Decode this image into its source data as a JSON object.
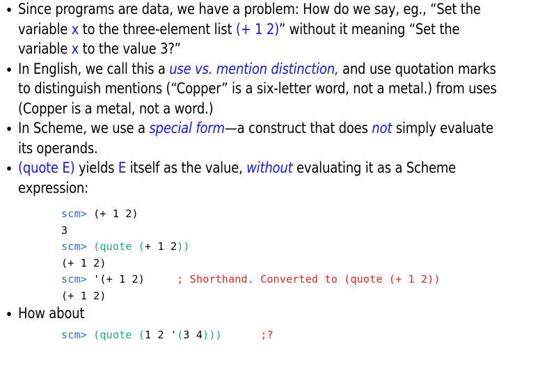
{
  "slide": {
    "background": "#ffffff",
    "accent_blue": "#1414f0",
    "code_prompt_blue": "#2e6fc4",
    "code_keyword_green": "#1eb07a",
    "code_paren_teal": "#17a98f",
    "code_comment_red": "#f42020"
  },
  "bullets": [
    {
      "id": "bullet-problem",
      "segments": [
        {
          "text": "Since programs are data, we have a problem:  How do we say, eg., “Set the variable ",
          "style": "plain"
        },
        {
          "text": "x",
          "style": "blue"
        },
        {
          "text": " to the three-element list ",
          "style": "plain"
        },
        {
          "text": "(+ 1 2)",
          "style": "blue"
        },
        {
          "text": "” without it meaning “Set the variable ",
          "style": "plain"
        },
        {
          "text": "x",
          "style": "blue"
        },
        {
          "text": " to the value 3?”",
          "style": "plain"
        }
      ]
    },
    {
      "id": "bullet-use-mention",
      "segments": [
        {
          "text": "In English, we call this a ",
          "style": "plain"
        },
        {
          "text": "use vs. mention distinction,",
          "style": "blue-italic"
        },
        {
          "text": " and use quotation marks to distinguish mentions (“Copper” is a six-letter word, not a metal.) from uses (Copper is a metal, not a word.)",
          "style": "plain"
        }
      ]
    },
    {
      "id": "bullet-special-form",
      "segments": [
        {
          "text": "In Scheme, we use a ",
          "style": "plain"
        },
        {
          "text": "special form",
          "style": "blue-italic"
        },
        {
          "text": "—a construct that does ",
          "style": "plain"
        },
        {
          "text": "not",
          "style": "blue-italic"
        },
        {
          "text": " simply evaluate its operands.",
          "style": "plain"
        }
      ]
    },
    {
      "id": "bullet-quote",
      "segments": [
        {
          "text": "(quote E)",
          "style": "blue"
        },
        {
          "text": " yields ",
          "style": "plain"
        },
        {
          "text": "E",
          "style": "blue"
        },
        {
          "text": " itself as the value, ",
          "style": "plain"
        },
        {
          "text": "without",
          "style": "blue-italic"
        },
        {
          "text": " evaluating it as a Scheme expression:",
          "style": "plain"
        }
      ]
    },
    {
      "id": "bullet-how-about",
      "segments": [
        {
          "text": "How about",
          "style": "plain"
        }
      ]
    }
  ],
  "code_block_first": {
    "id": "repl-transcript-main",
    "lines": [
      [
        {
          "text": "scm>",
          "style": "prompt"
        },
        {
          "text": " (+ 1 2)",
          "style": "plain"
        }
      ],
      [
        {
          "text": "3",
          "style": "plain"
        }
      ],
      [
        {
          "text": "scm>",
          "style": "prompt"
        },
        {
          "text": " ",
          "style": "plain"
        },
        {
          "text": "(",
          "style": "paren"
        },
        {
          "text": "quote",
          "style": "keyword"
        },
        {
          "text": " ",
          "style": "plain"
        },
        {
          "text": "(",
          "style": "paren"
        },
        {
          "text": "+ 1 2",
          "style": "plain"
        },
        {
          "text": "))",
          "style": "paren"
        }
      ],
      [
        {
          "text": "(+ 1 2)",
          "style": "plain"
        }
      ],
      [
        {
          "text": "scm>",
          "style": "prompt"
        },
        {
          "text": " '(+ 1 2)",
          "style": "plain"
        },
        {
          "text": "     ",
          "style": "plain"
        },
        {
          "text": "; Shorthand. Converted to (quote (+ 1 2))",
          "style": "comment"
        }
      ],
      [
        {
          "text": "(+ 1 2)",
          "style": "plain"
        }
      ]
    ]
  },
  "code_block_last": {
    "id": "repl-transcript-how-about",
    "lines": [
      [
        {
          "text": "scm>",
          "style": "prompt"
        },
        {
          "text": " ",
          "style": "plain"
        },
        {
          "text": "(",
          "style": "paren"
        },
        {
          "text": "quote",
          "style": "keyword"
        },
        {
          "text": " ",
          "style": "plain"
        },
        {
          "text": "(",
          "style": "paren"
        },
        {
          "text": "1 2 '",
          "style": "plain"
        },
        {
          "text": "(",
          "style": "paren"
        },
        {
          "text": "3 4",
          "style": "plain"
        },
        {
          "text": ")))",
          "style": "paren"
        },
        {
          "text": "      ",
          "style": "plain"
        },
        {
          "text": ";?",
          "style": "comment"
        }
      ]
    ]
  }
}
